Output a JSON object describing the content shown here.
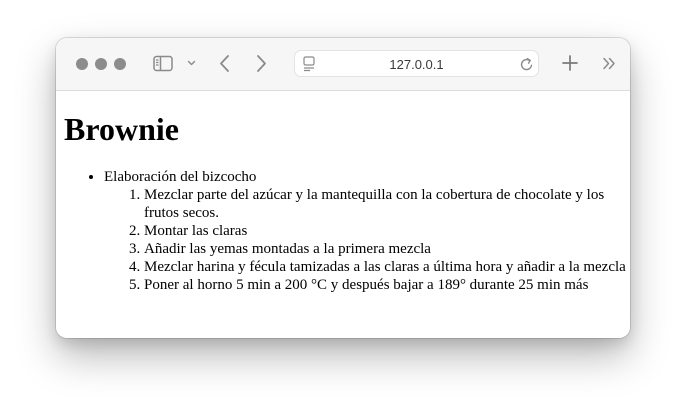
{
  "browser": {
    "url": "127.0.0.1"
  },
  "page": {
    "title": "Brownie",
    "sections": [
      {
        "label": "Elaboración del bizcocho",
        "steps": [
          "Mezclar parte del azúcar y la mantequilla con la cobertura de chocolate y los frutos secos.",
          "Montar las claras",
          "Añadir las yemas montadas a la primera mezcla",
          "Mezclar harina y fécula tamizadas a las claras a última hora y añadir a la mezcla",
          "Poner al horno 5 min a 200 °C y después bajar a 189° durante 25 min más"
        ]
      }
    ]
  },
  "icons": {
    "window_controls": [
      "close-button",
      "minimize-button",
      "zoom-button"
    ],
    "toolbar": [
      "sidebar-icon",
      "chevron-down-icon",
      "back-icon",
      "forward-icon",
      "page-icon",
      "reload-icon",
      "new-tab-icon",
      "more-icon"
    ]
  },
  "colors": {
    "toolbar_bg": "#f6f6f6",
    "traffic_light": "#8c8c8c",
    "icon": "#8a8a8a"
  }
}
